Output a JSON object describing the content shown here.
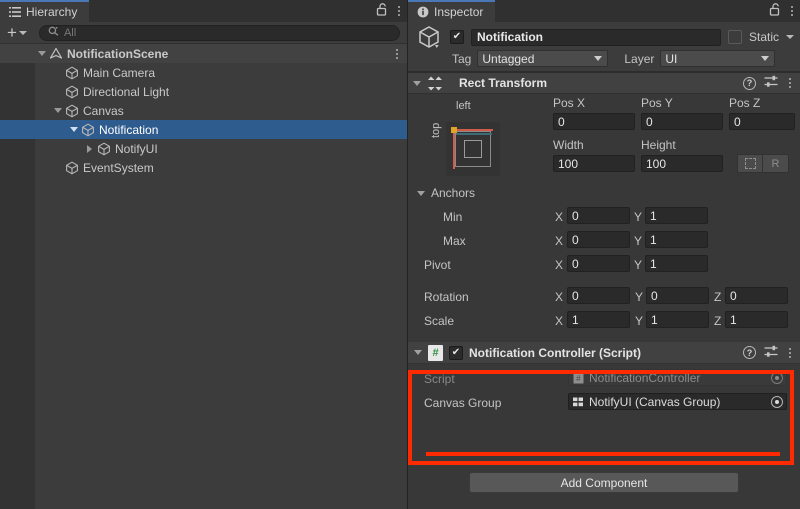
{
  "hierarchy": {
    "tab_label": "Hierarchy",
    "tab_icon": "hierarchy-list-icon",
    "lock_icon": "lock-open-icon",
    "menu_icon": "kebab-menu-icon",
    "toolbar": {
      "add_label": "+",
      "add_icon": "plus-icon",
      "dropdown_icon": "chevron-down-icon",
      "search_icon": "search-icon",
      "search_placeholder": "All",
      "search_value": ""
    },
    "items": [
      {
        "label": "NotificationScene",
        "icon": "unity-scene-icon",
        "depth": 0,
        "expanded": true,
        "selected": false,
        "has_arrow": true,
        "is_scene": true
      },
      {
        "label": "Main Camera",
        "icon": "gameobject-cube-icon",
        "depth": 1,
        "expanded": false,
        "selected": false,
        "has_arrow": false,
        "is_scene": false
      },
      {
        "label": "Directional Light",
        "icon": "gameobject-cube-icon",
        "depth": 1,
        "expanded": false,
        "selected": false,
        "has_arrow": false,
        "is_scene": false
      },
      {
        "label": "Canvas",
        "icon": "gameobject-cube-icon",
        "depth": 1,
        "expanded": true,
        "selected": false,
        "has_arrow": true,
        "is_scene": false
      },
      {
        "label": "Notification",
        "icon": "gameobject-cube-icon",
        "depth": 2,
        "expanded": true,
        "selected": true,
        "has_arrow": true,
        "is_scene": false
      },
      {
        "label": "NotifyUI",
        "icon": "gameobject-cube-icon",
        "depth": 3,
        "expanded": false,
        "selected": false,
        "has_arrow": true,
        "is_scene": false
      },
      {
        "label": "EventSystem",
        "icon": "gameobject-cube-icon",
        "depth": 1,
        "expanded": false,
        "selected": false,
        "has_arrow": false,
        "is_scene": false
      }
    ]
  },
  "inspector": {
    "tab_label": "Inspector",
    "tab_icon": "inspector-info-icon",
    "lock_icon": "lock-open-icon",
    "menu_icon": "kebab-menu-icon",
    "object": {
      "icon": "gameobject-cube-icon",
      "enabled": true,
      "name": "Notification",
      "static_label": "Static",
      "static_checked": false,
      "static_caret_icon": "chevron-down-icon",
      "tag_label": "Tag",
      "tag_value": "Untagged",
      "layer_label": "Layer",
      "layer_value": "UI"
    },
    "rect_transform": {
      "title": "Rect Transform",
      "icon": "rect-transform-icon",
      "expanded": true,
      "help_icon": "help-icon",
      "preset_icon": "preset-settings-icon",
      "menu_icon": "kebab-menu-icon",
      "anchor_preset": {
        "h_label": "left",
        "v_label": "top"
      },
      "pos": {
        "x_label": "Pos X",
        "x_value": "0",
        "y_label": "Pos Y",
        "y_value": "0",
        "z_label": "Pos Z",
        "z_value": "0"
      },
      "size": {
        "width_label": "Width",
        "width_value": "100",
        "height_label": "Height",
        "height_value": "100"
      },
      "blueprint_icon": "blueprint-mode-icon",
      "raw_label": "R",
      "anchors_label": "Anchors",
      "anchors": [
        {
          "label": "Min",
          "x_label": "X",
          "x_value": "0",
          "y_label": "Y",
          "y_value": "1"
        },
        {
          "label": "Max",
          "x_label": "X",
          "x_value": "0",
          "y_label": "Y",
          "y_value": "1"
        }
      ],
      "pivot": {
        "label": "Pivot",
        "x_label": "X",
        "x_value": "0",
        "y_label": "Y",
        "y_value": "1"
      },
      "rotation": {
        "label": "Rotation",
        "x_label": "X",
        "x_value": "0",
        "y_label": "Y",
        "y_value": "0",
        "z_label": "Z",
        "z_value": "0"
      },
      "scale": {
        "label": "Scale",
        "x_label": "X",
        "x_value": "1",
        "y_label": "Y",
        "y_value": "1",
        "z_label": "Z",
        "z_value": "1"
      }
    },
    "notification_controller": {
      "title": "Notification Controller (Script)",
      "icon": "csharp-script-icon",
      "icon_glyph": "#",
      "enabled": true,
      "expanded": true,
      "help_icon": "help-icon",
      "preset_icon": "preset-settings-icon",
      "menu_icon": "kebab-menu-icon",
      "script_label": "Script",
      "script_value": "NotificationController",
      "script_icon": "csharp-script-icon",
      "canvas_group_label": "Canvas Group",
      "canvas_group_value": "NotifyUI (Canvas Group)",
      "canvas_group_icon": "canvas-group-icon",
      "picker_icon": "object-picker-icon"
    },
    "add_component_label": "Add Component"
  },
  "annotations": {
    "highlight_color": "#ff2a00",
    "selection_color": "#2f5c8f"
  }
}
